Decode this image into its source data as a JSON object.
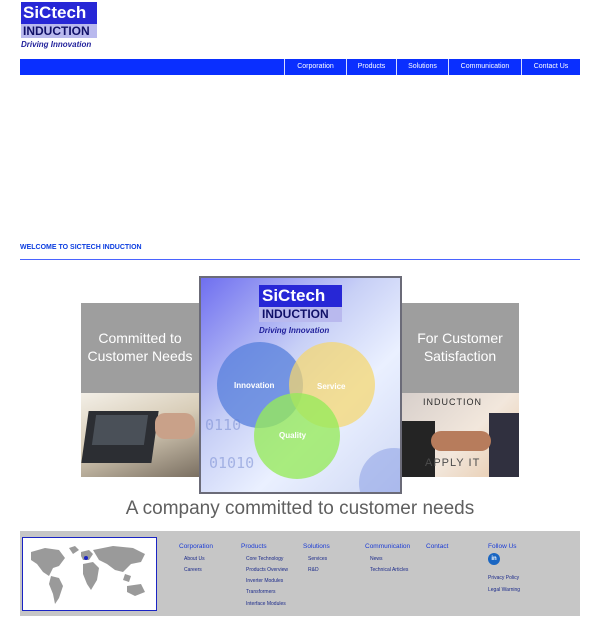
{
  "logo": {
    "line1": "SiCtech",
    "line2": "INDUCTION",
    "tagline": "Driving Innovation"
  },
  "nav": {
    "items": [
      "Corporation",
      "Products",
      "Solutions",
      "Communication",
      "Contact Us"
    ]
  },
  "welcome": "WELCOME TO SICTECH INDUCTION",
  "banner": {
    "left_text": "Committed to Customer Needs",
    "right_text": "For Customer Satisfaction",
    "logo_line1": "SiCtech",
    "logo_line2": "INDUCTION",
    "tagline": "Driving Innovation",
    "circles": [
      "Innovation",
      "Service",
      "Quality"
    ],
    "photo_right_top": "INDUCTION",
    "photo_right_bottom": "APPLY IT",
    "binary1": "0110",
    "binary2": "01010",
    "caption": "A company committed to customer needs"
  },
  "footer": {
    "columns": [
      {
        "heading": "Corporation",
        "links": [
          "About Us",
          "Careers"
        ]
      },
      {
        "heading": "Products",
        "links": [
          "Core Technology",
          "Products Overview",
          "Inverter Modules",
          "Transformers",
          "Interface Modules"
        ]
      },
      {
        "heading": "Solutions",
        "links": [
          "Services",
          "R&D"
        ]
      },
      {
        "heading": "Communication",
        "links": [
          "News",
          "Technical Articles"
        ]
      },
      {
        "heading": "Contact",
        "links": []
      },
      {
        "heading": "Follow Us",
        "links": [
          "Privacy Policy",
          "Legal Warning"
        ]
      }
    ],
    "linkedin_icon": "in"
  },
  "colors": {
    "nav_blue": "#0a2fff",
    "brand_blue": "#2727d6",
    "footer_gray": "#c6c6c6"
  }
}
